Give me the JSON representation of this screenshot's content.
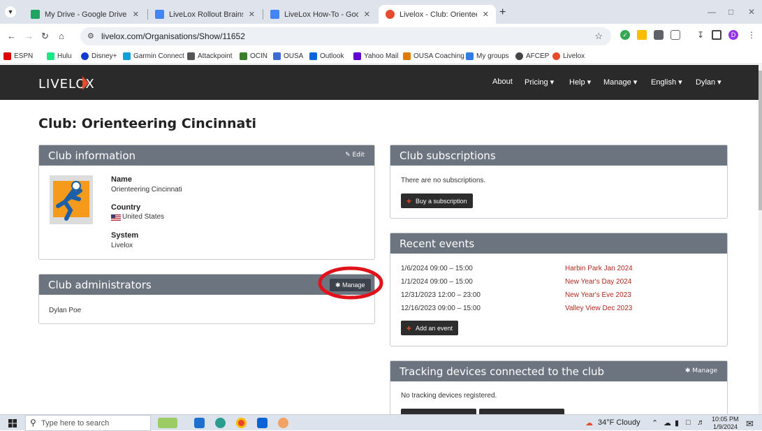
{
  "browser": {
    "tabs": [
      {
        "title": "My Drive - Google Drive",
        "color": "#1fa463",
        "active": false
      },
      {
        "title": "LiveLox Rollout Brainstorming - ",
        "color": "#4285f4",
        "active": false
      },
      {
        "title": "LiveLox How-To - Google Docs",
        "color": "#4285f4",
        "active": false
      },
      {
        "title": "Livelox - Club: Orienteering Cinc",
        "color": "#e84a2c",
        "active": true
      }
    ],
    "new_tab": "+",
    "url": "livelox.com/Organisations/Show/11652",
    "profile_initial": "D",
    "bookmarks": [
      {
        "label": "ESPN",
        "color": "#d00"
      },
      {
        "label": "Hulu",
        "color": "#1ce783"
      },
      {
        "label": "Disney+",
        "color": "#113ccf"
      },
      {
        "label": "Garmin Connect",
        "color": "#11a0db"
      },
      {
        "label": "Attackpoint",
        "color": "#555"
      },
      {
        "label": "OCIN",
        "color": "#3a7d2c"
      },
      {
        "label": "OUSA",
        "color": "#3d6bd6"
      },
      {
        "label": "Outlook",
        "color": "#0a64d6"
      },
      {
        "label": "Yahoo Mail",
        "color": "#6001d2"
      },
      {
        "label": "OUSA Coaching",
        "color": "#e07b00"
      },
      {
        "label": "My groups",
        "color": "#2e7de0"
      },
      {
        "label": "AFCEP",
        "color": "#444"
      },
      {
        "label": "Livelox",
        "color": "#e84a2c"
      }
    ]
  },
  "site": {
    "logo": "LIVELOX",
    "nav": [
      {
        "label": "About"
      },
      {
        "label": "Pricing ▾"
      },
      {
        "label": "Help ▾"
      },
      {
        "label": "Manage ▾"
      },
      {
        "label": "English ▾"
      },
      {
        "label": "Dylan ▾"
      }
    ]
  },
  "page": {
    "title": "Club: Orienteering Cincinnati",
    "club_info": {
      "header": "Club information",
      "edit": "✎ Edit",
      "name_label": "Name",
      "name": "Orienteering Cincinnati",
      "country_label": "Country",
      "country": "United States",
      "system_label": "System",
      "system": "Livelox"
    },
    "admins": {
      "header": "Club administrators",
      "manage": "✱ Manage",
      "items": [
        "Dylan Poe"
      ]
    },
    "subscriptions": {
      "header": "Club subscriptions",
      "empty": "There are no subscriptions.",
      "button": "Buy a subscription"
    },
    "events": {
      "header": "Recent events",
      "items": [
        {
          "date": "1/6/2024 09:00 – 15:00",
          "name": "Harbin Park Jan 2024"
        },
        {
          "date": "1/1/2024 09:00 – 15:00",
          "name": "New Year's Day 2024"
        },
        {
          "date": "12/31/2023 12:00 – 23:00",
          "name": "New Year's Eve 2023"
        },
        {
          "date": "12/16/2023 09:00 – 15:00",
          "name": "Valley View Dec 2023"
        }
      ],
      "button": "Add an event"
    },
    "devices": {
      "header": "Tracking devices connected to the club",
      "manage": "✱ Manage",
      "empty": "No tracking devices registered."
    }
  },
  "taskbar": {
    "search_placeholder": "Type here to search",
    "weather": "34°F  Cloudy",
    "time": "10:05 PM",
    "date": "1/9/2024"
  },
  "colors": {
    "accent": "#e84a2c",
    "panel_header": "#6c7480",
    "event_link": "#b0281e",
    "annotation": "#e0131a"
  }
}
